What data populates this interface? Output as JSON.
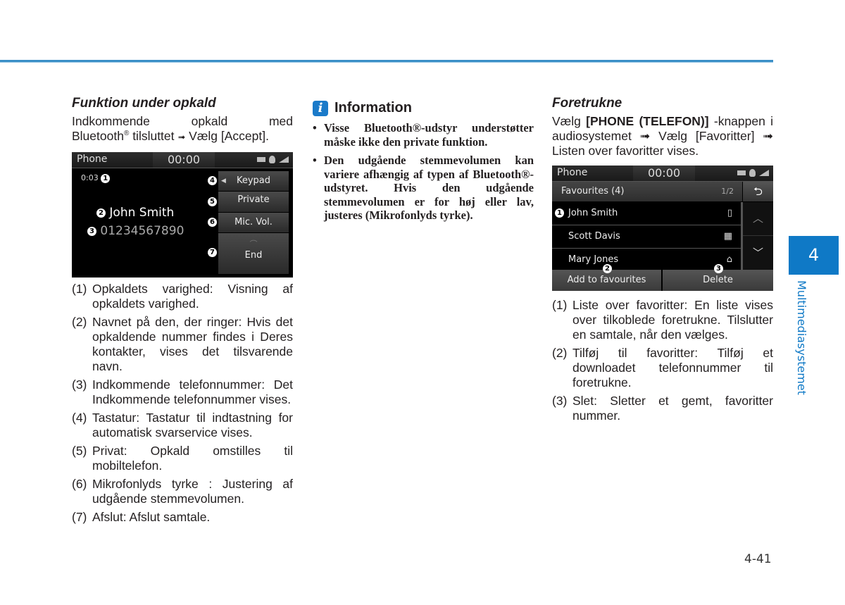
{
  "colors": {
    "accent": "#0f79c6",
    "rule": "#3a8fc7"
  },
  "col1": {
    "heading": "Funktion under opkald",
    "intro_line1": "Indkommende opkald med",
    "intro_line2_pre": "Bluetooth",
    "intro_line2_reg": "®",
    "intro_line2_post": " tilsluttet ",
    "intro_arrow": "➟",
    "intro_line2_end": " Vælg [Accept].",
    "screen": {
      "title": "Phone",
      "clock": "00:00",
      "duration": "0:03",
      "caller_name": "John Smith",
      "caller_number": "01234567890",
      "buttons": [
        {
          "label": "Keypad",
          "badge": "4"
        },
        {
          "label": "Private",
          "badge": "5"
        },
        {
          "label": "Mic. Vol.",
          "badge": "6"
        },
        {
          "label": "End",
          "badge": "7"
        }
      ],
      "badges": {
        "duration": "1",
        "name": "2",
        "number": "3"
      }
    },
    "items": [
      {
        "num": "(1)",
        "text": "Opkaldets varighed: Visning af opkaldets varighed."
      },
      {
        "num": "(2)",
        "text": "Navnet på den, der ringer: Hvis det opkaldende nummer findes i Deres kontakter, vises det tilsvarende navn."
      },
      {
        "num": "(3)",
        "text": "Indkommende telefonnummer: Det Indkommende telefonnummer vises."
      },
      {
        "num": "(4)",
        "text": "Tastatur: Tastatur til indtastning for automatisk svarservice vises."
      },
      {
        "num": "(5)",
        "text": "Privat: Opkald omstilles til mobiltelefon."
      },
      {
        "num": "(6)",
        "text": "Mikrofonlyds tyrke : Justering af udgående stemmevolumen."
      },
      {
        "num": "(7)",
        "text": "Afslut: Afslut samtale."
      }
    ]
  },
  "info": {
    "icon": "i",
    "title": "Information",
    "bullets": [
      {
        "bullet": "•",
        "text": "Visse Bluetooth®-udstyr understøtter måske ikke den private funktion."
      },
      {
        "bullet": "•",
        "text": "Den udgående stemmevolumen kan variere afhængig af typen af Bluetooth®-udstyret. Hvis den udgående stemmevolumen er for høj eller lav, justeres (Mikrofonlyds tyrke)."
      }
    ]
  },
  "col3": {
    "heading": "Foretrukne",
    "intro": "Vælg [PHONE (TELEFON)] -knappen i audiosystemet ➟ Vælg [Favoritter] ➟ Listen over favoritter vises.",
    "intro_pre": "Vælg ",
    "intro_bold": "[PHONE (TELEFON)]",
    "intro_post": " -knappen i audiosystemet ➟ Vælg [Favoritter] ➟ Listen over favoritter vises.",
    "screen": {
      "title": "Phone",
      "clock": "00:00",
      "list_title": "Favourites (4)",
      "page": "1/2",
      "back_icon": "⮌",
      "rows": [
        {
          "name": "John Smith",
          "icon": "▯",
          "icon_name": "mobile-phone-icon"
        },
        {
          "name": "Scott Davis",
          "icon": "▦",
          "icon_name": "office-icon"
        },
        {
          "name": "Mary Jones",
          "icon": "⌂",
          "icon_name": "home-icon"
        }
      ],
      "scroll_up": "︿",
      "scroll_down": "﹀",
      "add_button": "Add to favourites",
      "delete_button": "Delete",
      "badges": {
        "list": "1",
        "add": "2",
        "delete": "3"
      }
    },
    "items": [
      {
        "num": "(1)",
        "text": "Liste over favoritter: En liste vises over tilkoblede foretrukne. Tilslutter en samtale, når den vælges."
      },
      {
        "num": "(2)",
        "text": "Tilføj til favoritter: Tilføj et downloadet telefonnummer til foretrukne."
      },
      {
        "num": "(3)",
        "text": "Slet: Sletter et gemt, favoritter nummer."
      }
    ]
  },
  "side_tab": {
    "chapter": "4",
    "label": "Multimediasystemet"
  },
  "page_number": "4-41"
}
